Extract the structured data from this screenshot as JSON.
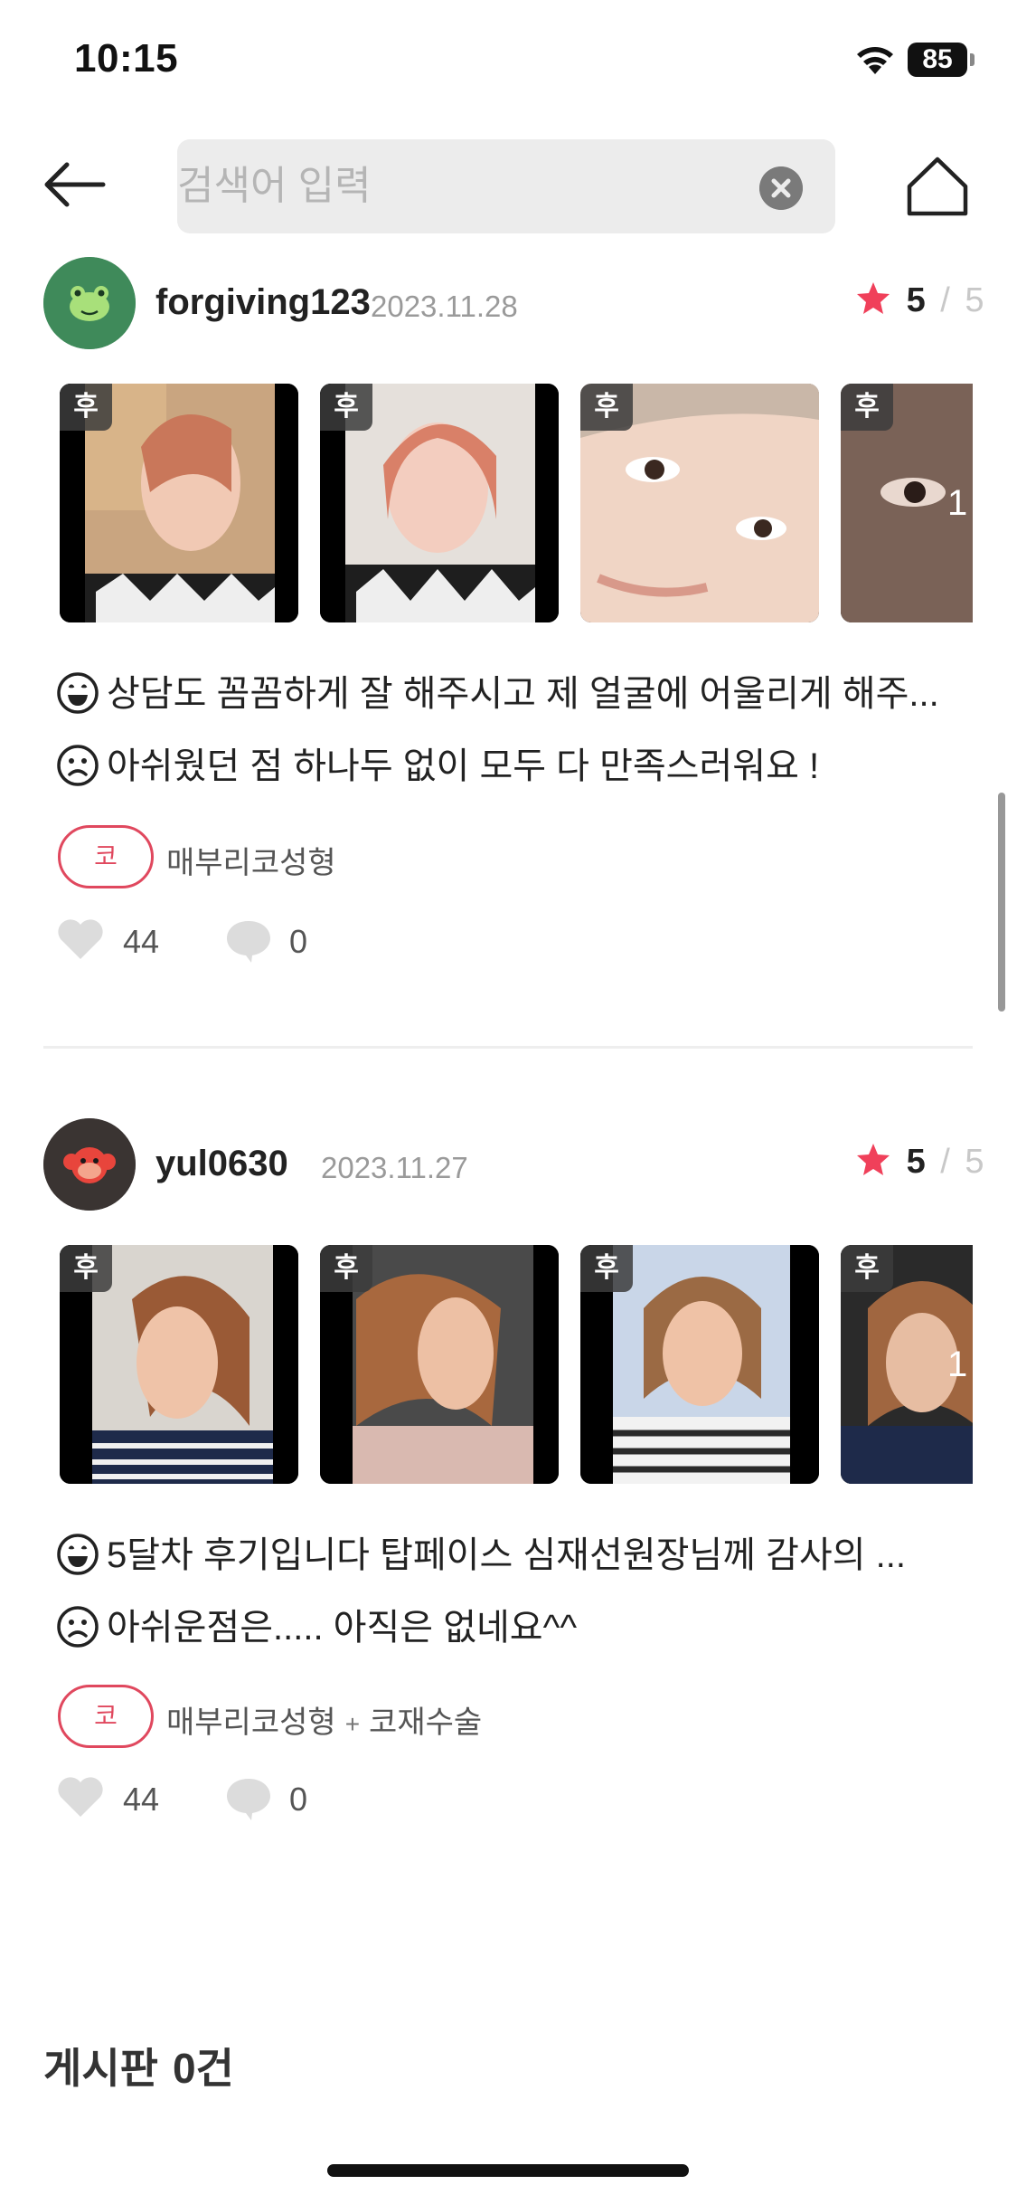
{
  "status_bar": {
    "time": "10:15",
    "battery": "85"
  },
  "search": {
    "placeholder": "검색어 입력",
    "value": ""
  },
  "reviews": [
    {
      "username": "forgiving123",
      "date": "2023.11.28",
      "rating": "5",
      "rating_max": "5",
      "photo_badge": "후",
      "more_count": "1",
      "positive": "상담도 꼼꼼하게 잘 해주시고 제 얼굴에 어울리게 해주...",
      "negative": "아쉬웠던 점 하나두 없이 모두 다 만족스러워요 !",
      "category_tag": "코",
      "procedure": "매부리코성형",
      "procedure_extra": "",
      "likes": "44",
      "comments": "0",
      "avatar_color": "#3f8a5a"
    },
    {
      "username": "yul0630",
      "date": "2023.11.27",
      "rating": "5",
      "rating_max": "5",
      "photo_badge": "후",
      "more_count": "1",
      "positive": "5달차 후기입니다 탑페이스 심재선원장님께 감사의 ...",
      "negative": "아쉬운점은..... 아직은 없네요^^",
      "category_tag": "코",
      "procedure": "매부리코성형",
      "procedure_plus": "+",
      "procedure_extra": "코재수술",
      "likes": "44",
      "comments": "0",
      "avatar_color": "#3a3432"
    }
  ],
  "board": {
    "label": "게시판",
    "count": "0건"
  },
  "colors": {
    "accent": "#e0485e",
    "star": "#f0405a"
  }
}
